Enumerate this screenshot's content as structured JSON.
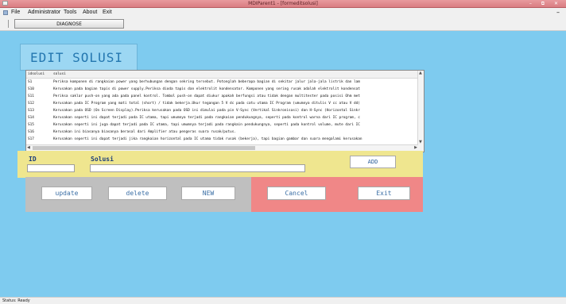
{
  "window": {
    "title": "MDIParent1 - [formeditsolusi]",
    "controls": "– ⧉ ✕"
  },
  "menu": {
    "items": [
      "File",
      "Administrator",
      "Tools",
      "About",
      "Exit"
    ]
  },
  "toolbar": {
    "diagnose_label": "DIAGNOSE"
  },
  "form": {
    "heading": "EDIT SOLUSI"
  },
  "grid": {
    "columns": [
      "idsolusi",
      "solusi"
    ],
    "rows": [
      [
        "S1",
        "Periksa komponen di rangkaian power yang berhubungan dengan sekring tersebut. Potonglah beberapa bagian di sekitar jalur jala-jala listrik dan lam"
      ],
      [
        "S10",
        "Kerusakan pada bagian tapis di power supply.Periksa dioda tapis dan elektrolit kondensator. Komponen yang sering rusak adalah elektrolit kondensat"
      ],
      [
        "S11",
        "Periksa saklar push-on yang ada pada panel kontrol. Tombol push-on dapat diukur apakah berfungsi atau tidak dengan multitester pada posisi Ohm met"
      ],
      [
        "S12",
        "Kerusakan pada IC Program yang mati total (short) / tidak bekerja.Ukur tegangan 5 V dc pada catu utama IC Program (umumnya ditulis V cc atau V dd)"
      ],
      [
        "S13",
        "Kerusakan pada OSD (On Screen Display).Periksa kerusakan pada OSD ini dimulai pada pin V-Sync (Vertikal Sinkronisasi) dan H-Sync (Horizontal Sinkr"
      ],
      [
        "S14",
        "Kerusakan seperti ini dapat terjadi pada IC utama, tapi umumnya terjadi pada rangkaian pendukungnya, seperti pada kontrol warna dari IC program, c"
      ],
      [
        "S15",
        "Kerusakan seperti ini juga dapat terjadi pada IC utama, tapi umumnya terjadi pada rangkain pendukungnya, seperti pada kontrol volume, mute dari IC"
      ],
      [
        "S16",
        "Kerusakan ini biasanya biasanya berasal dari Amplifier atau pengeras suara rusak/putus."
      ],
      [
        "S17",
        "Kerusakan seperti ini dapat terjadi jika rangkaian horizontal pada IC utama tidak rusak (bekerja), tapi bagian gambar dan suara mengalami kerusakan"
      ]
    ]
  },
  "inputs": {
    "id_label": "ID",
    "solusi_label": "Solusi",
    "id_value": "",
    "solusi_value": "",
    "add_label": "ADD"
  },
  "actions": {
    "update": "update",
    "delete": "delete",
    "new": "NEW",
    "cancel": "Cancel",
    "exit": "Exit"
  },
  "status": {
    "text": "Status: Ready"
  }
}
